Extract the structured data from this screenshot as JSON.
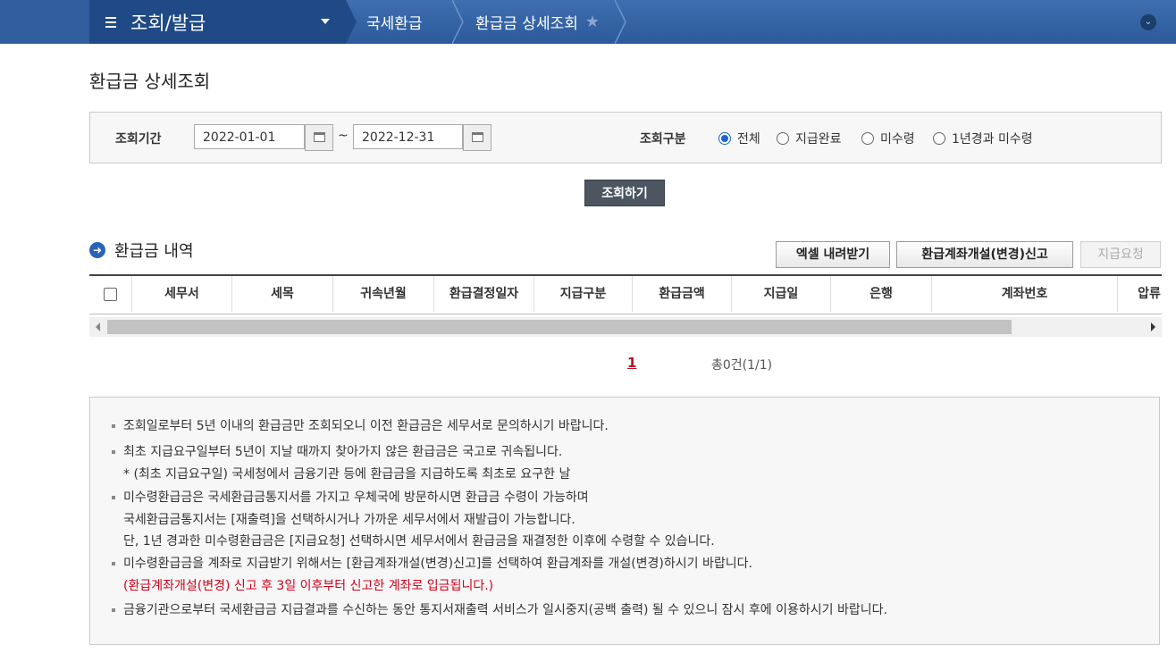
{
  "nav": {
    "menu_title": "조회/발급",
    "crumbs": [
      "국세환급",
      "환급금 상세조회"
    ]
  },
  "page_title": "환급금 상세조회",
  "search": {
    "period_label": "조회기간",
    "date_from": "2022-01-01",
    "date_to": "2022-12-31",
    "tilde": "~",
    "type_label": "조회구분",
    "options": [
      {
        "label": "전체",
        "selected": true
      },
      {
        "label": "지급완료",
        "selected": false
      },
      {
        "label": "미수령",
        "selected": false
      },
      {
        "label": "1년경과 미수령",
        "selected": false
      }
    ],
    "search_button": "조회하기"
  },
  "section": {
    "title": "환급금 내역",
    "excel_button": "엑셀 내려받기",
    "account_button": "환급계좌개설(변경)신고",
    "request_button": "지급요청"
  },
  "table": {
    "columns": [
      "세무서",
      "세목",
      "귀속년월",
      "환급결정일자",
      "지급구분",
      "환급금액",
      "지급일",
      "은행",
      "계좌번호",
      "압류"
    ]
  },
  "paging": {
    "current_page": "1",
    "total": "총0건(1/1)"
  },
  "notes": {
    "n1": "조회일로부터 5년 이내의 환급금만 조회되오니 이전 환급금은 세무서로 문의하시기 바랍니다.",
    "n2": "최초 지급요구일부터 5년이 지날 때까지 찾아가지 않은 환급금은 국고로 귀속됩니다.",
    "n2b": "* (최초 지급요구일) 국세청에서 금융기관 등에 환급금을 지급하도록 최초로 요구한 날",
    "n3": "미수령환급금은 국세환급금통지서를 가지고 우체국에 방문하시면 환급금 수령이 가능하며",
    "n3b": "국세환급금통지서는 [재출력]을 선택하시거나 가까운 세무서에서 재발급이 가능합니다.",
    "n3c": "단, 1년 경과한 미수령환급금은 [지급요청] 선택하시면 세무서에서 환급금을 재결정한 이후에 수령할 수 있습니다.",
    "n4": "미수령환급금을 계좌로 지급받기 위해서는 [환급계좌개설(변경)신고]를 선택하여 환급계좌를 개설(변경)하시기 바랍니다.",
    "n4b": "(환급계좌개설(변경) 신고 후 3일 이후부터 신고한 계좌로 입금됩니다.)",
    "n5": "금융기관으로부터 국세환급금 지급결과를 수신하는 동안 통지서재출력 서비스가 일시중지(공백 출력) 될 수 있으니 잠시 후에 이용하시기 바랍니다."
  }
}
